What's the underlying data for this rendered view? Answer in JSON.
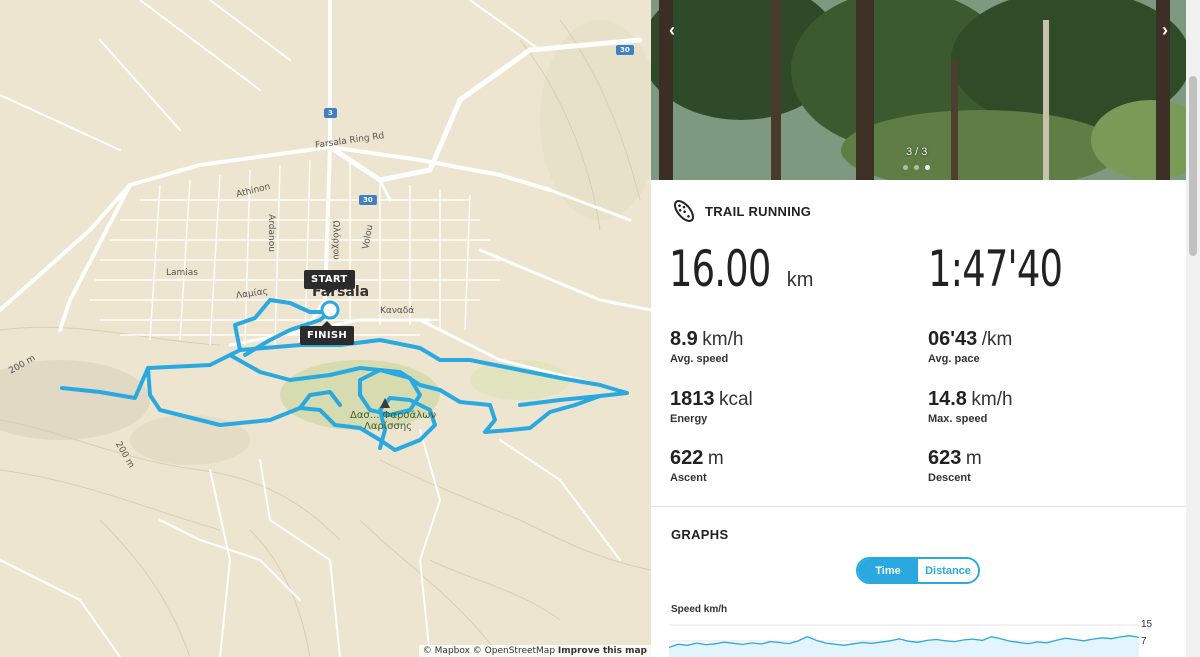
{
  "map": {
    "road_labels": [
      "Farsala Ring Rd",
      "Athinon",
      "Ardanou",
      "Lamias",
      "Λαμίας",
      "Καναδά",
      "Ωλόρχου",
      "Volou",
      "Λαμίας"
    ],
    "road_shields": [
      "3",
      "30",
      "30"
    ],
    "town_name": "Farsala",
    "park_name": "Δασ... Φαρσάλων",
    "park_name_2": "Λαρίσσης",
    "contours": [
      "200 m",
      "200 m"
    ],
    "start_label": "START",
    "finish_label": "FINISH",
    "attribution": {
      "mapbox": "© Mapbox",
      "osm": "© OpenStreetMap",
      "improve": "Improve this map"
    },
    "route_color": "#29a9e0"
  },
  "photo": {
    "prev_icon": "chevron-left-icon",
    "next_icon": "chevron-right-icon",
    "counter": "3 / 3",
    "dots": 3,
    "active_dot": 3
  },
  "activity": {
    "icon": "shoe-sole-icon",
    "label": "TRAIL RUNNING"
  },
  "stats": {
    "distance": {
      "value": "16.00",
      "unit": "km"
    },
    "duration": {
      "value": "1:47'40"
    },
    "avg_speed": {
      "value": "8.9",
      "unit": "km/h",
      "label": "Avg. speed"
    },
    "avg_pace": {
      "value": "06'43",
      "unit": "/km",
      "label": "Avg. pace"
    },
    "energy": {
      "value": "1813",
      "unit": "kcal",
      "label": "Energy"
    },
    "max_speed": {
      "value": "14.8",
      "unit": "km/h",
      "label": "Max. speed"
    },
    "ascent": {
      "value": "622",
      "unit": "m",
      "label": "Ascent"
    },
    "descent": {
      "value": "623",
      "unit": "m",
      "label": "Descent"
    }
  },
  "graphs": {
    "title": "GRAPHS",
    "toggle": {
      "time": "Time",
      "distance": "Distance",
      "selected": "Time"
    },
    "speed_label": "Speed km/h",
    "accent": "#29a9e0"
  },
  "chart_data": {
    "type": "line",
    "title": "Speed km/h",
    "y_ticks": [
      "15",
      "7"
    ],
    "ylim": [
      0,
      15
    ],
    "series": [
      {
        "values": [
          4.5,
          6,
          5.5,
          6.5,
          5.8,
          6.2,
          7,
          6.4,
          5.9,
          6.6,
          6.1,
          7.2,
          6.8,
          6.3,
          7.5,
          9.5,
          7.8,
          6.5,
          6,
          5.5,
          6.2,
          6.8,
          6.4,
          7,
          7.6,
          8.5,
          7.4,
          6.9,
          7.8,
          8.2,
          7.6,
          7.2,
          8,
          8.4,
          7.8,
          9.5,
          8.6,
          7.4,
          6.8,
          6.3,
          7.1,
          6.6,
          7.8,
          8.8,
          8.2,
          7.6,
          8.4,
          9,
          8.6,
          9.4,
          10,
          9.2
        ]
      }
    ]
  }
}
